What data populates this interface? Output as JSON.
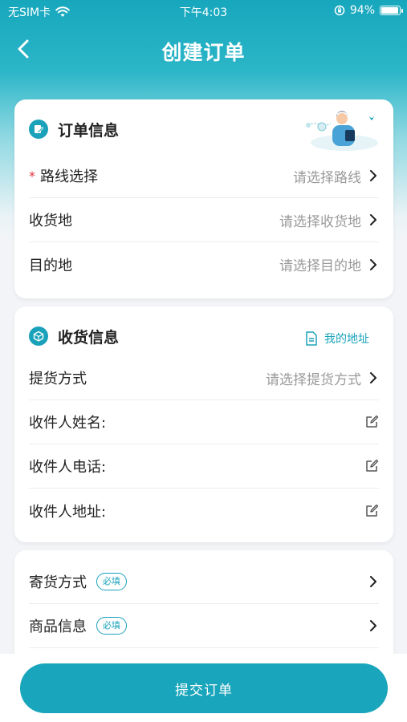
{
  "status_bar": {
    "carrier": "无SIM卡",
    "time": "下午4:03",
    "battery": "94%",
    "battery_level": 0.94
  },
  "nav": {
    "title": "创建订单",
    "back_icon": "chevron-left-icon"
  },
  "order_info": {
    "title": "订单信息",
    "rows": [
      {
        "label": "路线选择",
        "placeholder": "请选择路线",
        "required_mark": "*"
      },
      {
        "label": "收货地",
        "placeholder": "请选择收货地"
      },
      {
        "label": "目的地",
        "placeholder": "请选择目的地"
      }
    ]
  },
  "receive_info": {
    "title": "收货信息",
    "my_address": "我的地址",
    "rows": [
      {
        "label": "提货方式",
        "placeholder": "请选择提货方式"
      },
      {
        "label": "收件人姓名:"
      },
      {
        "label": "收件人电话:"
      },
      {
        "label": "收件人地址:"
      }
    ]
  },
  "misc_info": {
    "rows": [
      {
        "label": "寄货方式",
        "badge": "必填"
      },
      {
        "label": "商品信息",
        "badge": "必填"
      }
    ]
  },
  "submit": {
    "label": "提交订单"
  },
  "colors": {
    "accent": "#1aa2ba",
    "required": "#e0313a"
  }
}
